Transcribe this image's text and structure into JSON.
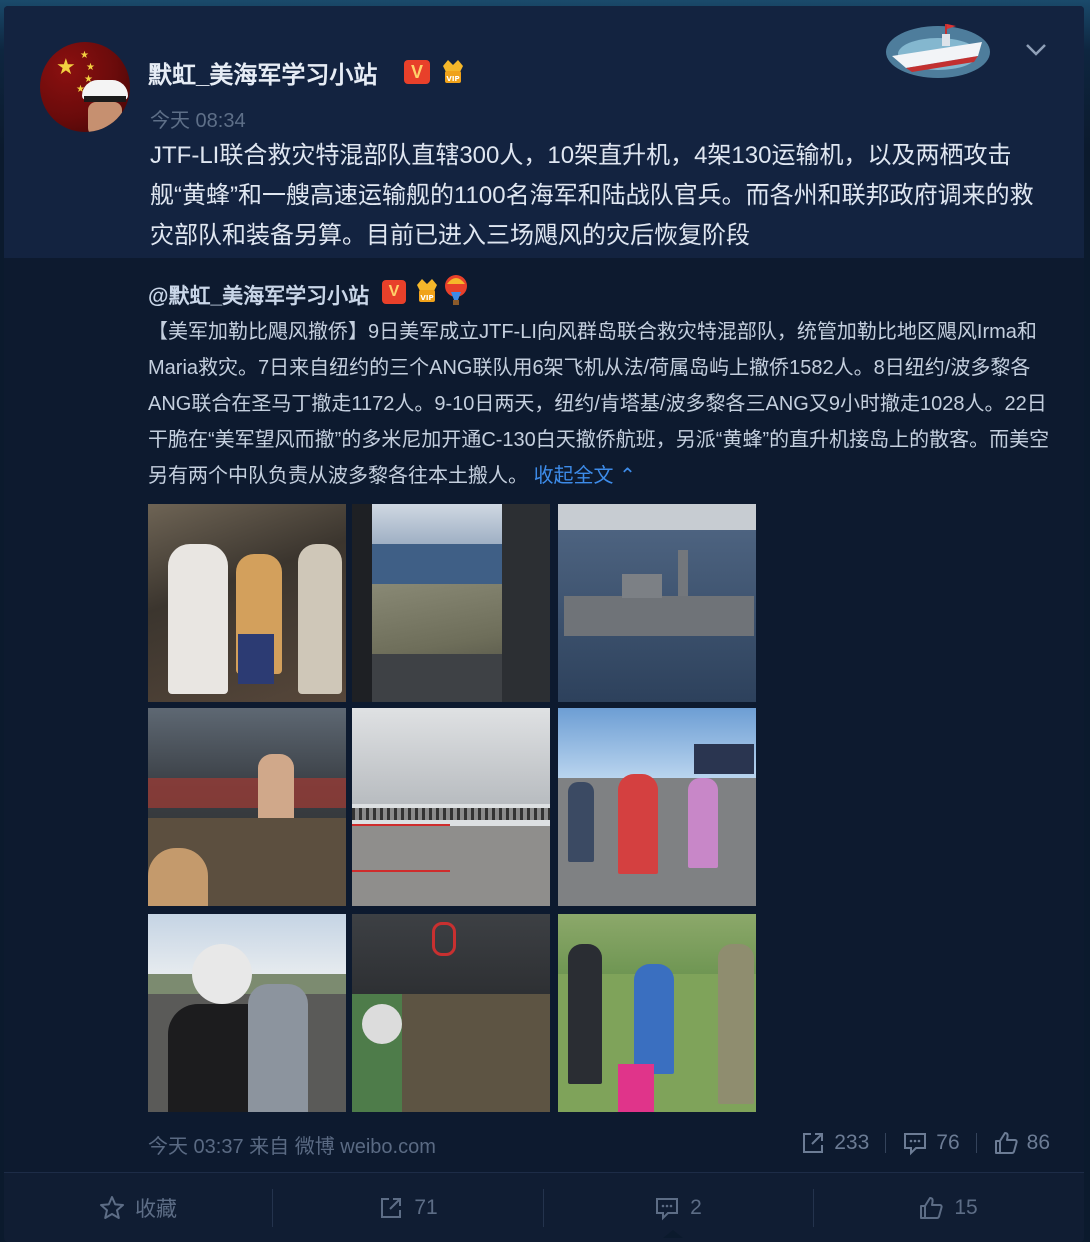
{
  "post": {
    "username": "默虹_美海军学习小站",
    "verified_badge": "V",
    "vip_badge": "VIP",
    "timestamp": "今天 08:34",
    "text": "JTF-LI联合救灾特混部队直辖300人，10架直升机，4架130运输机，以及两栖攻击舰“黄蜂”和一艘高速运输舰的1100名海军和陆战队官兵。而各州和联邦政府调来的救灾部队和装备另算。目前已进入三场飓风的灾后恢复阶段",
    "icons": {
      "decor": "ship-icon",
      "menu": "chevron-down-icon"
    }
  },
  "repost": {
    "username": "@默虹_美海军学习小站",
    "verified_badge": "V",
    "vip_badge": "VIP",
    "text": "【美军加勒比飓风撤侨】9日美军成立JTF-LI向风群岛联合救灾特混部队，统管加勒比地区飓风Irma和Maria救灾。7日来自纽约的三个ANG联队用6架飞机从法/荷属岛屿上撤侨1582人。8日纽约/波多黎各ANG联合在圣马丁撤走1172人。9-10日两天，纽约/肯塔基/波多黎各三ANG又9小时撤走1028人。22日干脆在“美军望风而撤”的多米尼加开通C-130白天撤侨航班，另派“黄蜂”的直升机接岛上的散客。而美空另有两个中队负责从波多黎各往本土搬人。",
    "collapse_label": "收起全文",
    "photos": [
      "cargo-plane-evacuees-photo",
      "aerial-island-view-photo",
      "amphibious-ship-photo",
      "aircraft-hold-crowd-photo",
      "airport-queue-photo",
      "airfield-crowd-photo",
      "helmet-crew-photo",
      "helicopter-cabin-photo",
      "field-evacuees-photo"
    ],
    "footer_time_source": "今天 03:37 来自 微博 weibo.com",
    "stats": {
      "reposts": "233",
      "comments": "76",
      "likes": "86"
    }
  },
  "actions": {
    "favorite_label": "收藏",
    "repost_count": "71",
    "comment_count": "2",
    "like_count": "15"
  },
  "colors": {
    "background": "#0b1a2d",
    "card": "#132340",
    "repost_bg": "#0d1a2f",
    "link": "#3d8be8",
    "verified": "#e8402a"
  }
}
